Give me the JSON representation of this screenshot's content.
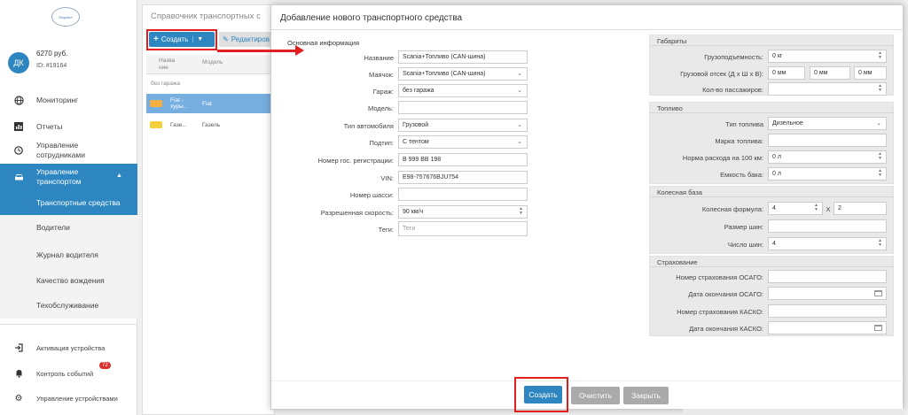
{
  "sidebar": {
    "logo_text": "Dispatch",
    "avatar": "ДК",
    "balance": "6270 руб.",
    "user_id": "ID: #19164",
    "items": [
      {
        "label": "Мониторинг",
        "icon": "globe-icon"
      },
      {
        "label": "Отчеты",
        "icon": "bar-chart-icon"
      },
      {
        "label": "Управление сотрудниками",
        "icon": "clock-icon"
      },
      {
        "label": "Управление транспортом",
        "icon": "car-icon"
      }
    ],
    "sub_items": [
      "Транспортные средства",
      "Водители",
      "Журнал водителя",
      "Качество вождения",
      "Техобслуживание"
    ],
    "bottom_items": [
      {
        "label": "Активация устройства",
        "icon": "login-icon"
      },
      {
        "label": "Контроль событий",
        "icon": "bell-icon"
      },
      {
        "label": "Управление устройствами",
        "icon": "gear-icon"
      }
    ],
    "badge": "72"
  },
  "background": {
    "title": "Справочник транспортных с",
    "create_btn": "Создать",
    "edit_btn": "Редактиров",
    "col_name": "Назва ние",
    "col_model": "Модель",
    "group": "без гаража",
    "rows": [
      {
        "name": "Fiat - хуры...",
        "model": "Fiat"
      },
      {
        "name": "Газе...",
        "model": "Газель"
      }
    ]
  },
  "modal": {
    "title": "Добавление нового транспортного средства",
    "section_basic": "Основная информация",
    "fields": {
      "name": {
        "label": "Название",
        "value": "Scania+Топливо (CAN-шина)"
      },
      "beacon": {
        "label": "Маячок:",
        "value": "Scania+Топливо (CAN-шина)"
      },
      "garage": {
        "label": "Гараж:",
        "value": "без гаража"
      },
      "model": {
        "label": "Модель:",
        "value": ""
      },
      "type": {
        "label": "Тип автомобиля",
        "value": "Грузовой"
      },
      "subtype": {
        "label": "Подтип:",
        "value": "С тентом"
      },
      "reg": {
        "label": "Номер гос. регистрации:",
        "value": "В 999 ВВ 198"
      },
      "vin": {
        "label": "VIN:",
        "value": "E98-757676BJU754"
      },
      "chassis": {
        "label": "Номер шасси:",
        "value": ""
      },
      "speed": {
        "label": "Разрешенная скорость:",
        "value": "90 км/ч"
      },
      "tags": {
        "label": "Теги:",
        "placeholder": "Теги"
      }
    },
    "dims": {
      "legend": "Габариты",
      "capacity_label": "Грузоподъемность:",
      "capacity": "0 кг",
      "cargo_label": "Грузовой отсек (Д x Ш x В):",
      "cargo_l": "0 мм",
      "cargo_w": "0 мм",
      "cargo_h": "0 мм",
      "pass_label": "Кол-во пассажиров:",
      "pass": ""
    },
    "fuel": {
      "legend": "Топливо",
      "type_label": "Тип топлива",
      "type": "Дизельное",
      "brand_label": "Марка топлива:",
      "brand": "",
      "rate_label": "Норма расхода на 100 км:",
      "rate": "0 л",
      "tank_label": "Емкость бака:",
      "tank": "0 л"
    },
    "wheels": {
      "legend": "Колесная база",
      "formula_label": "Колесная формула:",
      "formula_a": "4",
      "formula_x": "X",
      "formula_b": "2",
      "size_label": "Размер шин:",
      "size": "",
      "count_label": "Число шин:",
      "count": "4"
    },
    "insurance": {
      "legend": "Страхование",
      "osago_num_label": "Номер страхования ОСАГО:",
      "osago_num": "",
      "osago_date_label": "Дата окончания ОСАГО:",
      "osago_date": "",
      "kasko_num_label": "Номер страхования КАСКО:",
      "kasko_num": "",
      "kasko_date_label": "Дата окончания КАСКО:",
      "kasko_date": ""
    },
    "buttons": {
      "create": "Создать",
      "clear": "Очистить",
      "close": "Закрыть"
    }
  },
  "colors": {
    "accent": "#2e86c1",
    "highlight": "#e21e1e",
    "badge": "#d9302c"
  }
}
